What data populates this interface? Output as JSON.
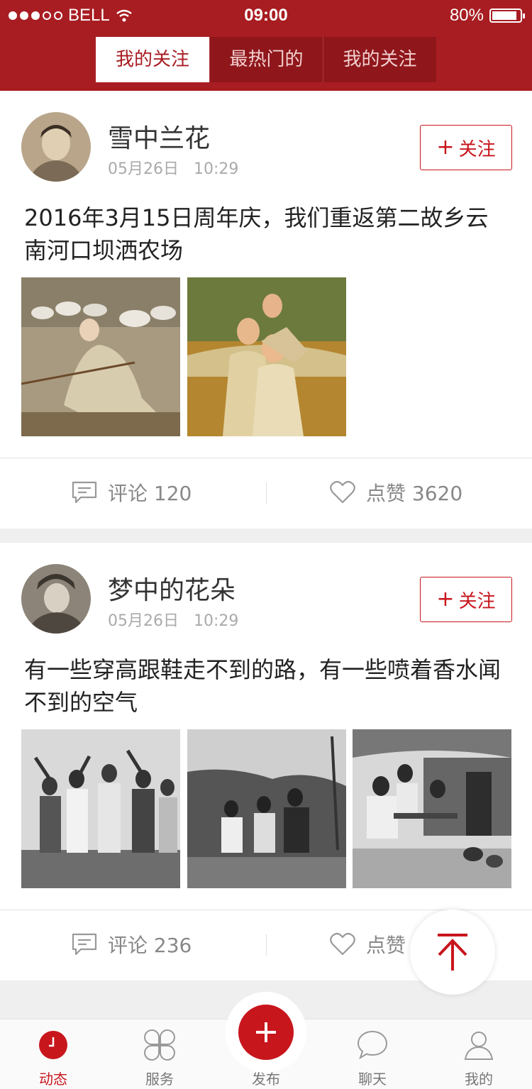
{
  "status_bar": {
    "carrier": "BELL",
    "time": "09:00",
    "battery": "80%"
  },
  "tabs": [
    {
      "label": "我的关注",
      "active": true
    },
    {
      "label": "最热门的",
      "active": false
    },
    {
      "label": "我的关注",
      "active": false
    }
  ],
  "posts": [
    {
      "username": "雪中兰花",
      "date": "05月26日",
      "time": "10:29",
      "follow_label": "关注",
      "text": "2016年3月15日周年庆，我们重返第二故乡云南河口坝洒农场",
      "comment_label": "评论 120",
      "like_label": "点赞 3620"
    },
    {
      "username": "梦中的花朵",
      "date": "05月26日",
      "time": "10:29",
      "follow_label": "关注",
      "text": "有一些穿高跟鞋走不到的路，有一些喷着香水闻不到的空气",
      "comment_label": "评论 236",
      "like_label": "点赞 1"
    }
  ],
  "nav": [
    {
      "label": "动态",
      "icon": "clock-icon",
      "active": true
    },
    {
      "label": "服务",
      "icon": "grid-icon",
      "active": false
    },
    {
      "label": "发布",
      "icon": "plus-icon",
      "active": false
    },
    {
      "label": "聊天",
      "icon": "chat-icon",
      "active": false
    },
    {
      "label": "我的",
      "icon": "user-icon",
      "active": false
    }
  ],
  "colors": {
    "brand": "#a81d22",
    "accent": "#c8161d"
  }
}
